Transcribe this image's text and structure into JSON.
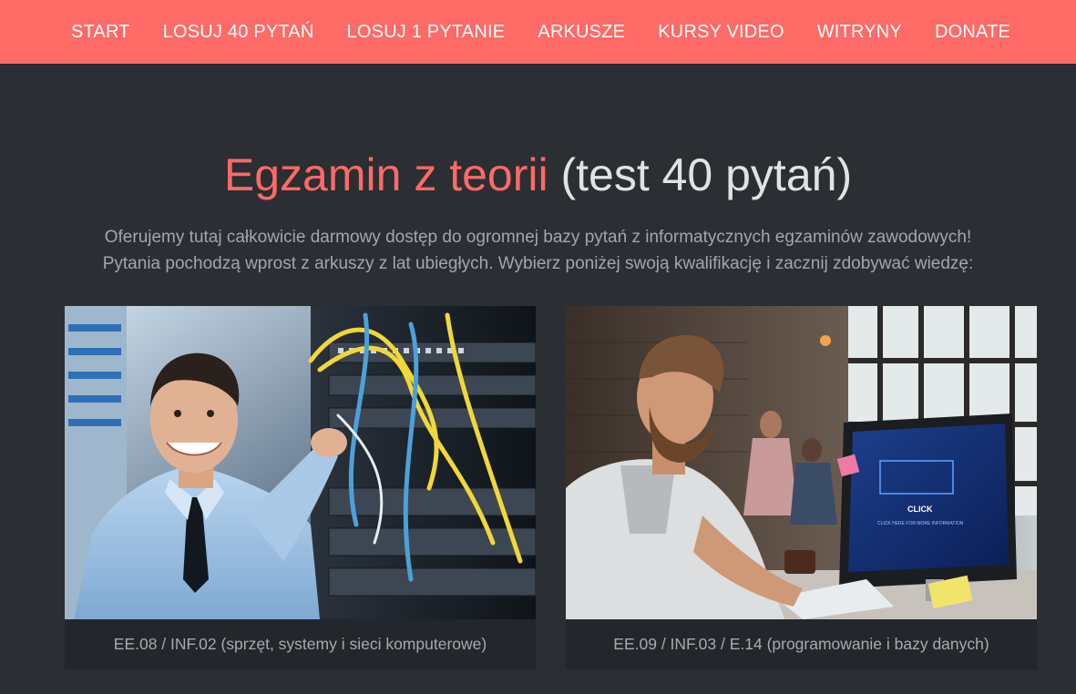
{
  "nav": {
    "items": [
      "START",
      "LOSUJ 40 PYTAŃ",
      "LOSUJ 1 PYTANIE",
      "ARKUSZE",
      "KURSY VIDEO",
      "WITRYNY",
      "DONATE"
    ]
  },
  "hero": {
    "title_accent": "Egzamin z teorii",
    "title_rest": " (test 40 pytań)"
  },
  "lead": {
    "line1": "Oferujemy tutaj całkowicie darmowy dostęp do ogromnej bazy pytań z informatycznych egzaminów zawodowych!",
    "line2": "Pytania pochodzą wprost z arkuszy z lat ubiegłych. Wybierz poniżej swoją kwalifikację i zacznij zdobywać wiedzę:"
  },
  "cards": [
    {
      "caption": "EE.08 / INF.02 (sprzęt, systemy i sieci komputerowe)",
      "image": "technician-at-server-rack"
    },
    {
      "caption": "EE.09 / INF.03 / E.14 (programowanie i bazy danych)",
      "image": "developer-at-desktop-computer"
    }
  ],
  "screen": {
    "click_label": "CLICK",
    "sub_label": "CLICK HERE FOR MORE INFORMATION"
  },
  "colors": {
    "accent": "#fe6a65",
    "background": "#2b2e33",
    "card": "#23262b"
  }
}
